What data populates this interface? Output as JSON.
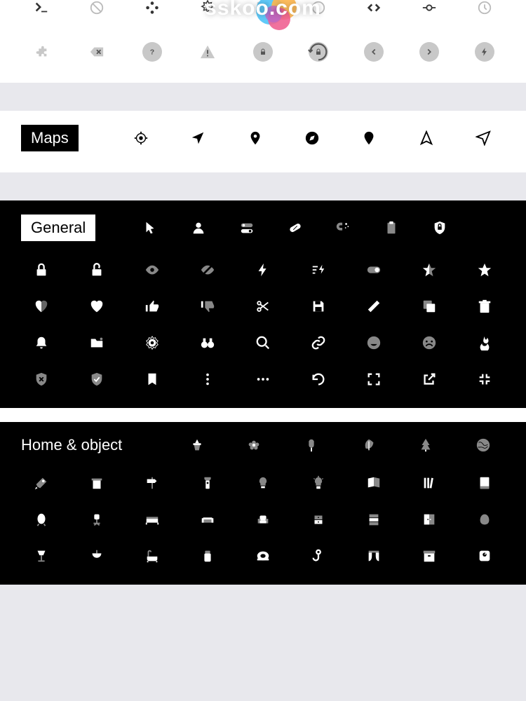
{
  "watermark": "sskoo.com",
  "sections": {
    "maps": {
      "label": "Maps"
    },
    "general": {
      "label": "General"
    },
    "home": {
      "label": "Home & object"
    }
  }
}
